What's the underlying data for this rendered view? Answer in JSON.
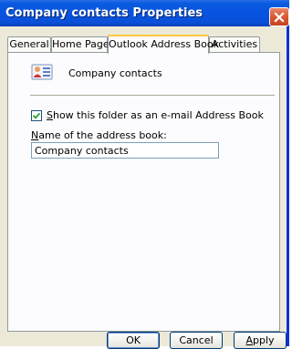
{
  "window": {
    "title": "Company contacts Properties"
  },
  "tabs": [
    {
      "label": "General",
      "active": false
    },
    {
      "label": "Home Page",
      "active": false
    },
    {
      "label": "Outlook Address Book",
      "active": true
    },
    {
      "label": "Activities",
      "active": false
    }
  ],
  "panel": {
    "folder_icon": "address-book-icon",
    "folder_name": "Company contacts",
    "show_as_address_book": {
      "label_access_key": "S",
      "label_rest": "how this folder as an e-mail Address Book",
      "checked": true
    },
    "address_book_name": {
      "label_access_key": "N",
      "label_rest": "ame of the address book:",
      "value": "Company contacts"
    }
  },
  "buttons": {
    "ok": "OK",
    "cancel": "Cancel",
    "apply_access_key": "A",
    "apply_rest": "pply"
  },
  "colors": {
    "titlebar": "#0854e0",
    "close_button": "#d9592e",
    "active_tab_highlight": "#ffc73c",
    "dialog_background": "#ece9d8"
  }
}
